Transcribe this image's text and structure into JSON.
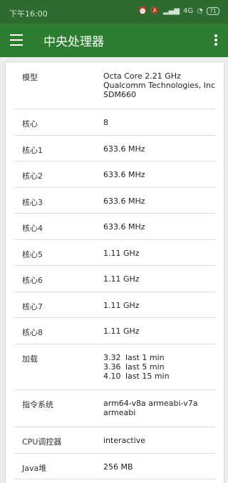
{
  "status_bar": {
    "time": "下午16:00",
    "network": "4G",
    "battery": "71"
  },
  "app_bar": {
    "title": "中央处理器"
  },
  "rows": {
    "model": {
      "label": "模型",
      "lines": [
        "Octa Core 2.21 GHz",
        "Qualcomm Technologies, Inc",
        "SDM660"
      ]
    },
    "cores": {
      "label": "核心",
      "value": "8"
    },
    "core1": {
      "label": "核心1",
      "value": "633.6 MHz"
    },
    "core2": {
      "label": "核心2",
      "value": "633.6 MHz"
    },
    "core3": {
      "label": "核心3",
      "value": "633.6 MHz"
    },
    "core4": {
      "label": "核心4",
      "value": "633.6 MHz"
    },
    "core5": {
      "label": "核心5",
      "value": "1.11 GHz"
    },
    "core6": {
      "label": "核心6",
      "value": "1.11 GHz"
    },
    "core7": {
      "label": "核心7",
      "value": "1.11 GHz"
    },
    "core8": {
      "label": "核心8",
      "value": "1.11 GHz"
    },
    "load": {
      "label": "加载",
      "lines": [
        {
          "value": "3.32",
          "period": "last 1 min"
        },
        {
          "value": "3.36",
          "period": "last 5 min"
        },
        {
          "value": "4.10",
          "period": "last 15 min"
        }
      ]
    },
    "isa": {
      "label": "指令系统",
      "lines": [
        "arm64-v8a armeabi-v7a",
        "armeabi"
      ]
    },
    "governor": {
      "label": "CPU调控器",
      "value": "interactive"
    },
    "java_heap": {
      "label": "Java堆",
      "value": "256 MB"
    }
  }
}
